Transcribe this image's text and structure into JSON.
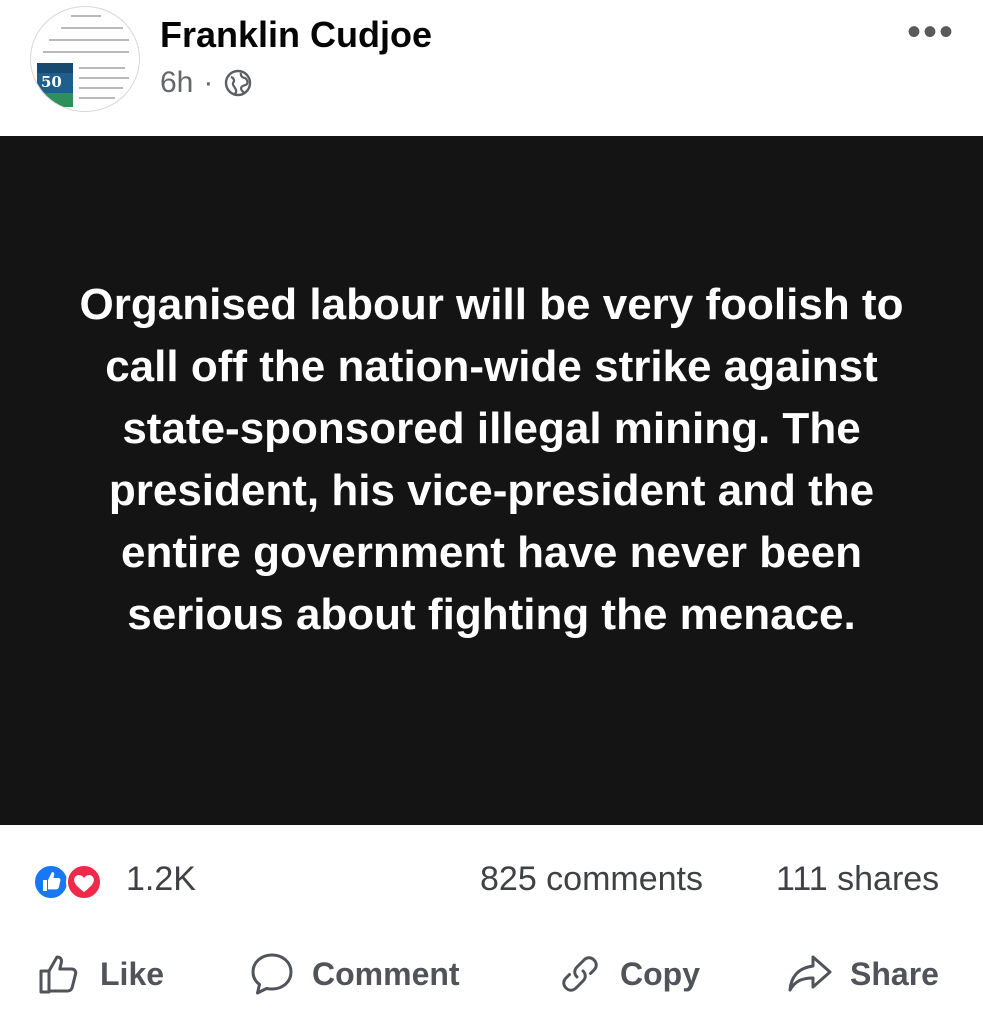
{
  "post": {
    "author": "Franklin Cudjoe",
    "time": "6h",
    "separator": "·",
    "audience_icon": "globe-icon",
    "more_icon": "more-options-icon",
    "more_label": "•••",
    "body": "Organised labour will be very foolish to call off the nation-wide strike against state-sponsored illegal mining. The president, his vice-president and the entire government have never been serious about fighting the menace.",
    "background_color": "#141414",
    "text_color": "#ffffff"
  },
  "stats": {
    "reaction_icons": [
      "like-icon",
      "love-icon"
    ],
    "reactions": "1.2K",
    "comments": "825 comments",
    "shares": "111 shares"
  },
  "actions": {
    "like": "Like",
    "comment": "Comment",
    "copy": "Copy",
    "share": "Share"
  },
  "colors": {
    "like_blue": "#1877f2",
    "love_red": "#f02849",
    "muted_text": "#65676b"
  }
}
